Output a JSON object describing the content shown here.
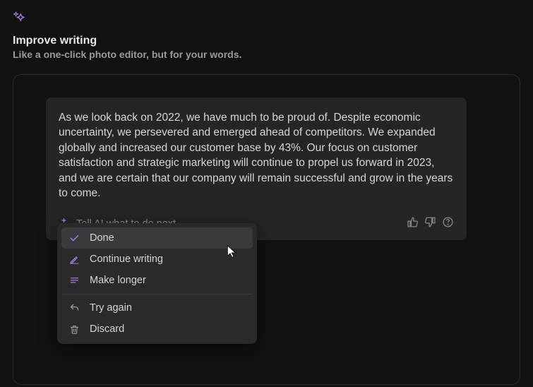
{
  "header": {
    "title": "Improve writing",
    "subtitle": "Like a one-click photo editor, but for your words."
  },
  "ai_card": {
    "text": "As we look back on 2022, we have much to be proud of. Despite economic uncertainty, we persevered and emerged ahead of competitors. We expanded globally and increased our customer base by 43%. Our focus on customer satisfaction and strategic marketing will continue to propel us forward in 2023, and we are certain that our company will remain successful and grow in the years to come.",
    "input_placeholder": "Tell AI what to do next..."
  },
  "menu": {
    "done": "Done",
    "continue_writing": "Continue writing",
    "make_longer": "Make longer",
    "try_again": "Try again",
    "discard": "Discard"
  }
}
